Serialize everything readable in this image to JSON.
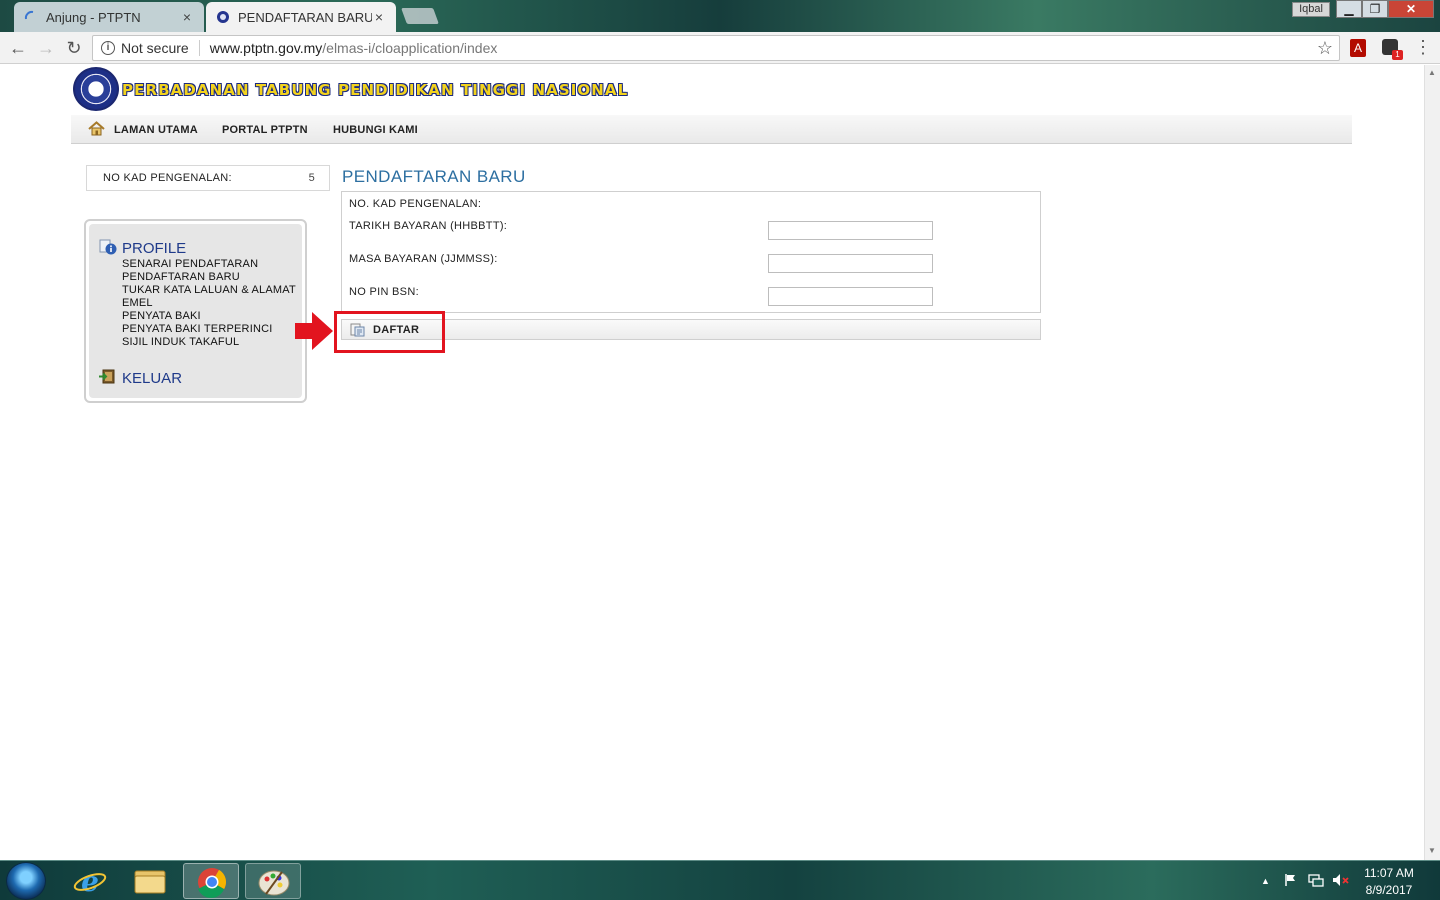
{
  "browser": {
    "tabs": [
      {
        "title": "Anjung - PTPTN",
        "close": "×"
      },
      {
        "title": "PENDAFTARAN BARU",
        "close": "×"
      }
    ],
    "user_badge": "Iqbal",
    "window_controls": {
      "minimize": "▁",
      "maximize": "❐",
      "close": "✕"
    },
    "nav": {
      "back": "←",
      "forward": "→",
      "reload": "↻"
    },
    "security_label": "Not secure",
    "url_host": "www.ptptn.gov.my",
    "url_path": "/elmas-i/cloapplication/index",
    "star": "☆",
    "menu": "⋮",
    "extension_badge": "1",
    "acrobat_label": "A"
  },
  "site": {
    "logo_text": "PERBADANAN TABUNG PENDIDIKAN TINGGI NASIONAL",
    "nav": {
      "home": "LAMAN UTAMA",
      "portal": "PORTAL PTPTN",
      "contact": "HUBUNGI KAMI"
    }
  },
  "identity": {
    "label": "NO KAD PENGENALAN:",
    "value": "5"
  },
  "sidebar": {
    "profile_title": "PROFILE",
    "links": [
      "SENARAI PENDAFTARAN",
      "PENDAFTARAN BARU",
      "TUKAR KATA LALUAN & ALAMAT",
      "EMEL",
      "PENYATA BAKI",
      "PENYATA BAKI TERPERINCI",
      "SIJIL INDUK TAKAFUL"
    ],
    "logout": "KELUAR"
  },
  "form": {
    "heading": "PENDAFTARAN BARU",
    "ic_label": "NO. KAD PENGENALAN:",
    "date_label": "TARIKH BAYARAN (HHBBTT):",
    "time_label": "MASA BAYARAN (JJMMSS):",
    "pin_label": "NO PIN BSN:",
    "date_value": "",
    "time_value": "",
    "pin_value": "",
    "submit": "DAFTAR"
  },
  "annotation": {
    "color": "#e2141f"
  },
  "taskbar": {
    "time": "11:07 AM",
    "date": "8/9/2017",
    "tray_up": "▲"
  }
}
